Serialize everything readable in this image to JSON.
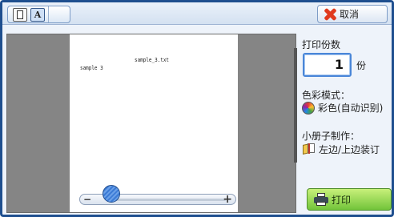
{
  "toolbar": {
    "view_mode_letter": "A",
    "cancel_label": "取消"
  },
  "preview": {
    "page_header": "sample_3.txt",
    "page_body": "sample 3",
    "zoom_minus": "−",
    "zoom_plus": "+",
    "zoom_level_fraction": 0.12
  },
  "settings": {
    "copies_label": "打印份数",
    "copies_value": "1",
    "copies_unit": "份",
    "color_mode_label": "色彩模式：",
    "color_mode_value": "彩色(自动识别)",
    "booklet_label": "小册子制作：",
    "booklet_value": "左边/上边装订"
  },
  "actions": {
    "print_label": "打印"
  },
  "colors": {
    "frame_border": "#1f4f8f",
    "preview_background": "#858585",
    "print_button": "#72c43a",
    "cancel_icon": "#e03a1e",
    "copies_focus": "#4a86d8"
  }
}
